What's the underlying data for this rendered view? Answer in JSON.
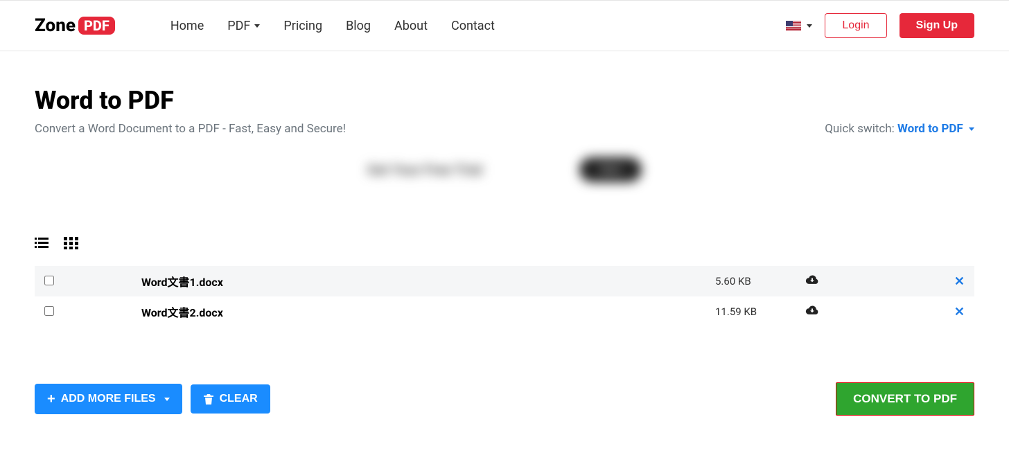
{
  "logo": {
    "zone": "Zone",
    "pdf": "PDF"
  },
  "nav": {
    "home": "Home",
    "pdf": "PDF",
    "pricing": "Pricing",
    "blog": "Blog",
    "about": "About",
    "contact": "Contact"
  },
  "auth": {
    "login": "Login",
    "signup": "Sign Up"
  },
  "page": {
    "title": "Word to PDF",
    "subtitle": "Convert a Word Document to a PDF - Fast, Easy and Secure!",
    "quick_switch_label": "Quick switch: ",
    "quick_switch_value": "Word to PDF"
  },
  "ad": {
    "text": "Get Your Free Trial",
    "btn": "Start"
  },
  "files": [
    {
      "name": "Word文書1.docx",
      "size": "5.60 KB"
    },
    {
      "name": "Word文書2.docx",
      "size": "11.59 KB"
    }
  ],
  "actions": {
    "add_more": "ADD MORE FILES",
    "clear": "CLEAR",
    "convert": "CONVERT TO PDF"
  }
}
